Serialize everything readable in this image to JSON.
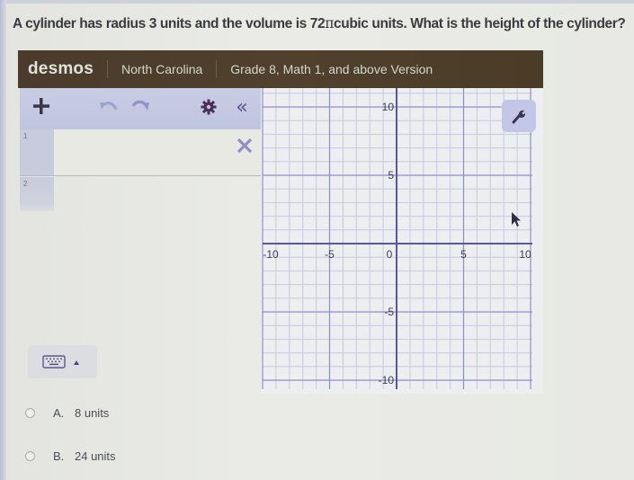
{
  "question": {
    "prefix": "A cylinder has radius 3 units and the volume is 72",
    "pi_symbol": "π",
    "suffix": "cubic units. What is the height of the cylinder?"
  },
  "desmos": {
    "brand": "desmos",
    "state": "North Carolina",
    "version": "Grade 8, Math 1, and above Version",
    "toolbar": {
      "add_icon": "plus-icon",
      "undo_icon": "undo-icon",
      "redo_icon": "redo-icon",
      "settings_icon": "gear-icon",
      "collapse_icon": "double-chevron-left-icon",
      "collapse_glyph": "«"
    },
    "expressions": [
      {
        "index": "1",
        "value": ""
      },
      {
        "index": "2",
        "value": ""
      }
    ],
    "keypad_icon": "keyboard-icon",
    "graph": {
      "x_range": [
        -10,
        10
      ],
      "y_range": [
        -10,
        10
      ],
      "minor_step": 1,
      "major_step": 5,
      "x_ticks": [
        "-10",
        "-5",
        "0",
        "5",
        "10"
      ],
      "y_ticks": [
        "10",
        "5",
        "-5",
        "-10"
      ],
      "settings_icon": "wrench-icon"
    },
    "colors": {
      "header_bg": "#4a3b2c",
      "toolbar_bg": "#c4c8e1",
      "axis": "#5a55a0",
      "major_grid": "#8f8fc6",
      "minor_grid": "#c8c9e3",
      "accent": "#5a4f92"
    }
  },
  "answers": [
    {
      "letter": "A.",
      "text": "8 units",
      "selected": false
    },
    {
      "letter": "B.",
      "text": "24 units",
      "selected": false
    }
  ]
}
